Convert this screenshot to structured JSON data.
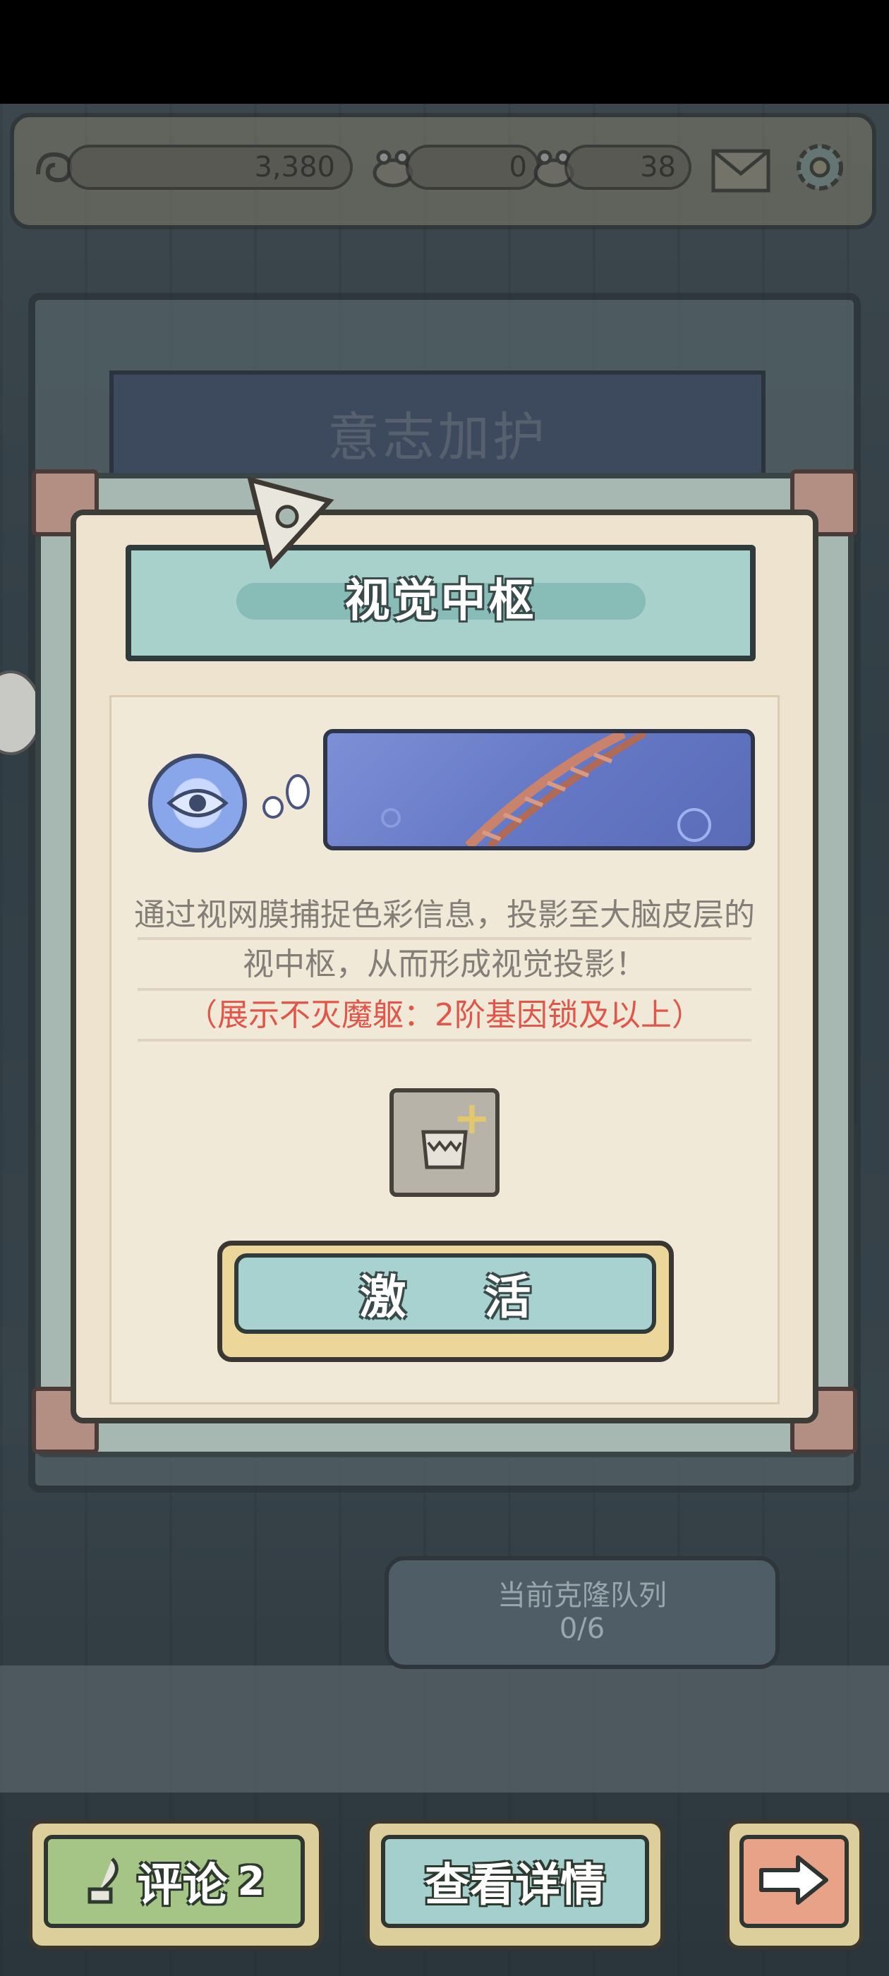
{
  "resources": {
    "coins": "3,380",
    "frogs": "0",
    "gems": "38"
  },
  "background_title": "意志加护",
  "dialog": {
    "title": "视觉中枢",
    "description_line1": "通过视网膜捕捉色彩信息，投影至大脑皮层的",
    "description_line2": "视中枢，从而形成视觉投影！",
    "requirement": "（展示不灭魔躯：2阶基因锁及以上）",
    "activate_label": "激 活"
  },
  "queue": {
    "label": "当前克隆队列",
    "value": "0/6"
  },
  "bottom": {
    "comment_label": "评论",
    "comment_count": "2",
    "details_label": "查看详情"
  },
  "icons": [
    "spiral-coin-icon",
    "frog-icon",
    "frog-icon-2",
    "mail-icon",
    "gear-icon",
    "eye-icon",
    "monster-item-icon",
    "plus-icon",
    "quill-icon",
    "arrow-right-icon"
  ]
}
